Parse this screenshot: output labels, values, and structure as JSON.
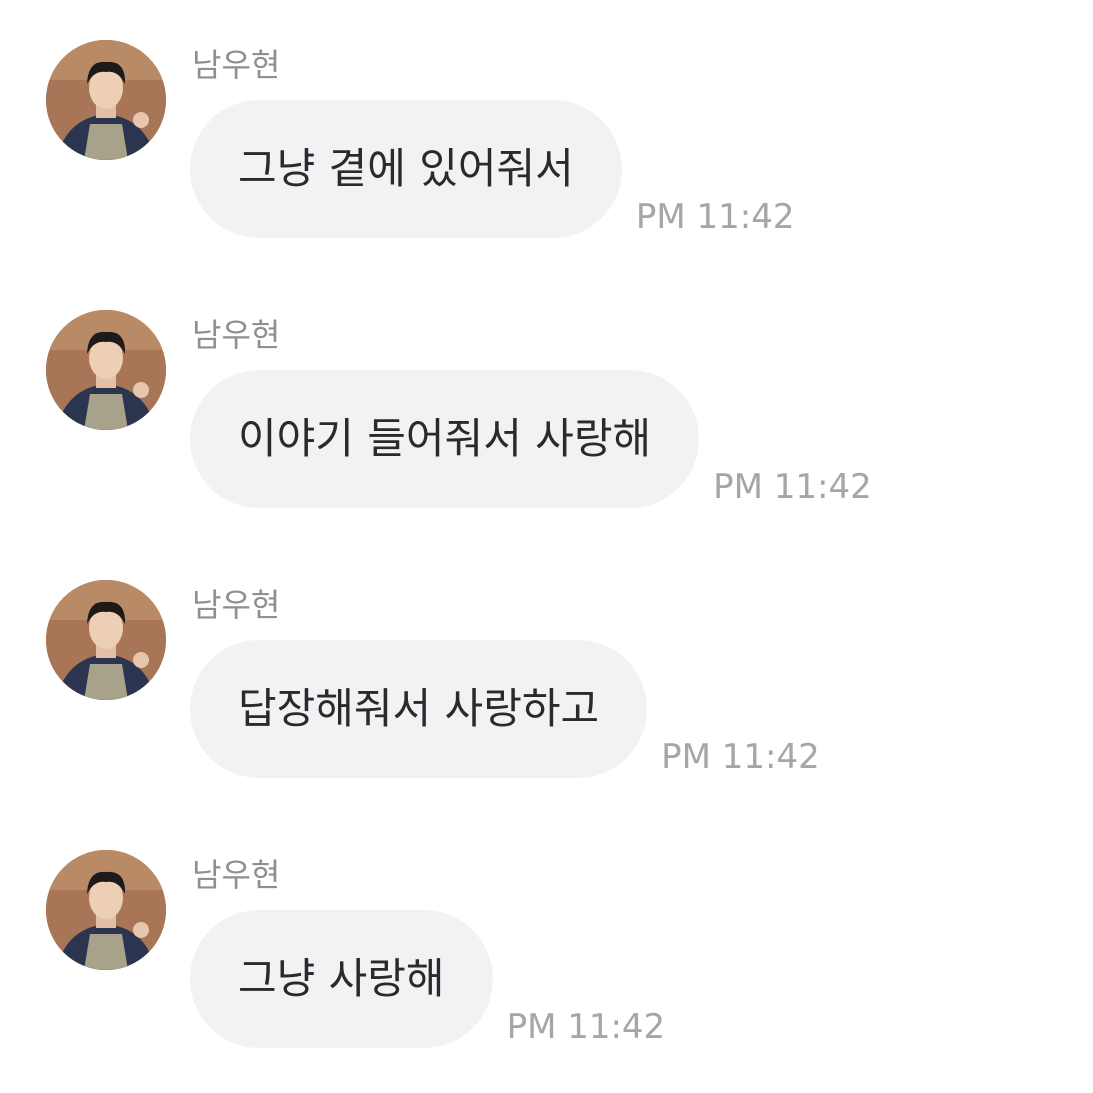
{
  "messages": [
    {
      "sender": "남우현",
      "text": "그냥 곁에 있어줘서",
      "time": "PM 11:42",
      "avatar_icon": "profile-photo"
    },
    {
      "sender": "남우현",
      "text": "이야기 들어줘서 사랑해",
      "time": "PM 11:42",
      "avatar_icon": "profile-photo"
    },
    {
      "sender": "남우현",
      "text": "답장해줘서 사랑하고",
      "time": "PM 11:42",
      "avatar_icon": "profile-photo"
    },
    {
      "sender": "남우현",
      "text": "그냥 사랑해",
      "time": "PM 11:42",
      "avatar_icon": "profile-photo"
    }
  ],
  "colors": {
    "background": "#ffffff",
    "bubble": "#f2f2f5",
    "message_text": "#2a2a2c",
    "sender_text": "#8e8e93",
    "time_text": "#a5a5aa"
  }
}
